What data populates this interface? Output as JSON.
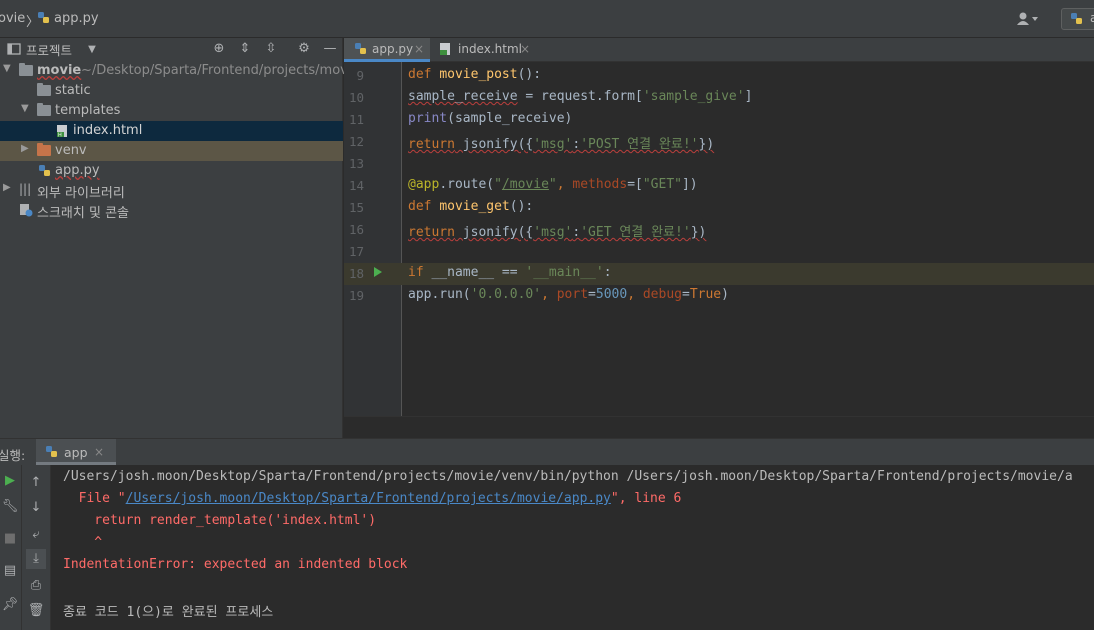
{
  "topbar": {
    "project": "ovie",
    "separator": "〉",
    "file": "app.py",
    "run_config_label": "a"
  },
  "project_panel": {
    "title": "프로젝트",
    "tree": [
      {
        "label": "movie",
        "path": "~/Desktop/Sparta/Frontend/projects/movie"
      },
      {
        "label": "static"
      },
      {
        "label": "templates"
      },
      {
        "label": "index.html"
      },
      {
        "label": "venv"
      },
      {
        "label": "app.py"
      },
      {
        "label": "외부 라이브러리"
      },
      {
        "label": "스크래치 및 콘솔"
      }
    ]
  },
  "editor": {
    "tabs": [
      {
        "label": "app.py",
        "close": "×"
      },
      {
        "label": "index.html",
        "close": "×"
      }
    ],
    "lines": [
      {
        "num": "9"
      },
      {
        "num": "10"
      },
      {
        "num": "11"
      },
      {
        "num": "12"
      },
      {
        "num": "13"
      },
      {
        "num": "14"
      },
      {
        "num": "15"
      },
      {
        "num": "16"
      },
      {
        "num": "17"
      },
      {
        "num": "18"
      },
      {
        "num": "19"
      }
    ],
    "code": {
      "l9_kw": "def",
      "l9_fn": "movie_post",
      "l9_rest": "():",
      "l10_a": "sample_receive",
      "l10_b": " = request.form[",
      "l10_str": "'sample_give'",
      "l10_c": "]",
      "l11_bi": "print",
      "l11_rest": "(sample_receive)",
      "l12_kw": "return",
      "l12_a": " jsonify({",
      "l12_s1": "'msg'",
      "l12_colon": ":",
      "l12_s2": "'POST 연결 완료!'",
      "l12_end": "})",
      "l14_dec": "@app",
      "l14_a": ".route(",
      "l14_s1": "\"",
      "l14_route": "/movie",
      "l14_s2": "\"",
      "l14_comma": ", ",
      "l14_param": "methods",
      "l14_eq": "=[",
      "l14_s3": "\"GET\"",
      "l14_end": "])",
      "l15_kw": "def",
      "l15_fn": "movie_get",
      "l15_rest": "():",
      "l16_kw": "return",
      "l16_a": " jsonify({",
      "l16_s1": "'msg'",
      "l16_colon": ":",
      "l16_s2": "'GET 연결 완료!'",
      "l16_end": "})",
      "l18_kw": "if",
      "l18_a": " __name__ == ",
      "l18_str": "'__main__'",
      "l18_end": ":",
      "l19_a": "app",
      "l19_b": ".run(",
      "l19_s1": "'0.0.0.0'",
      "l19_c": ", ",
      "l19_p1": "port",
      "l19_eq1": "=",
      "l19_n": "5000",
      "l19_c2": ", ",
      "l19_p2": "debug",
      "l19_eq2": "=",
      "l19_kw": "True",
      "l19_end": ")"
    }
  },
  "run_panel": {
    "label": "실행:",
    "tab": {
      "label": "app",
      "close": "×"
    },
    "output": {
      "cmd": "/Users/josh.moon/Desktop/Sparta/Frontend/projects/movie/venv/bin/python /Users/josh.moon/Desktop/Sparta/Frontend/projects/movie/a",
      "file_prefix": "  File \"",
      "file_link": "/Users/josh.moon/Desktop/Sparta/Frontend/projects/movie/app.py",
      "file_suffix": "\", line 6",
      "return_line": "    return render_template('index.html')",
      "caret": "    ^",
      "error": "IndentationError: expected an indented block",
      "exit": "종료 코드 1(으)로 완료된 프로세스"
    }
  },
  "colors": {
    "background": "#2b2b2b",
    "panel": "#3c3f41",
    "keyword": "#cc7832",
    "function": "#ffc66d",
    "string": "#6a8759",
    "number": "#6897bb",
    "error": "#ff6b68",
    "link": "#4a88c7"
  },
  "icons": [
    "python-file-icon",
    "folder-icon",
    "html-file-icon",
    "run-icon",
    "wrench-icon",
    "stop-icon",
    "pin-icon",
    "trash-icon",
    "print-icon",
    "up-arrow-icon",
    "down-arrow-icon",
    "wrap-icon",
    "scroll-end-icon",
    "user-icon",
    "gear-icon",
    "locate-icon",
    "expand-icon",
    "collapse-icon",
    "minimize-icon",
    "library-icon",
    "scratch-icon"
  ]
}
